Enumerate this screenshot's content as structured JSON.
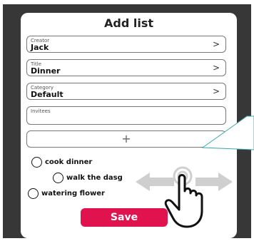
{
  "dialog": {
    "title": "Add list"
  },
  "fields": {
    "creator": {
      "label": "Creator",
      "value": "Jack"
    },
    "title": {
      "label": "Title",
      "value": "Dinner"
    },
    "category": {
      "label": "Category",
      "value": "Default"
    },
    "invitees": {
      "label": "Invitees"
    }
  },
  "chevron": ">",
  "add_button": {
    "label": "+"
  },
  "todos": [
    {
      "text": "cook dinner"
    },
    {
      "text": "walk the dasg"
    },
    {
      "text": "watering flower"
    }
  ],
  "save_button": {
    "label": "Save"
  },
  "colors": {
    "accent": "#e0134f",
    "background": "#373737",
    "gesture_arrow": "#cfcfcf"
  },
  "gesture": {
    "icon": "hand-tap-icon",
    "direction": "horizontal-swipe"
  }
}
